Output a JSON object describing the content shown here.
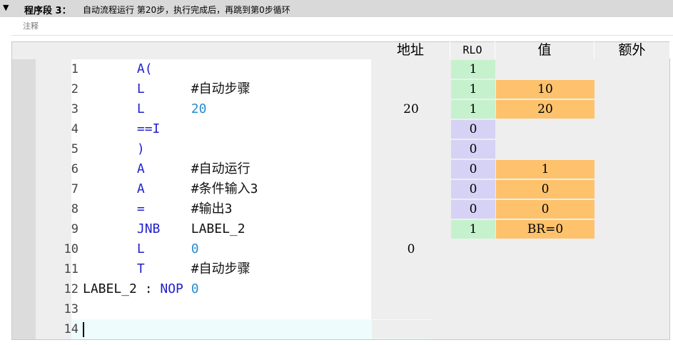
{
  "header": {
    "collapse_icon": "triangle-down-icon",
    "segment_title": "程序段 3：",
    "segment_description": "自动流程运行 第20步，执行完成后，再跳到第0步循环"
  },
  "comment_label": "注释",
  "columns": {
    "address": "地址",
    "rlo": "RLO",
    "value": "值",
    "extra": "额外"
  },
  "rows": [
    {
      "line": "1",
      "op": "A(",
      "operand": "",
      "operand_type": "none",
      "address": "",
      "rlo": "1",
      "value": "",
      "extra": ""
    },
    {
      "line": "2",
      "op": "L",
      "operand": "#自动步骤",
      "operand_type": "text",
      "address": "",
      "rlo": "1",
      "value": "10",
      "extra": ""
    },
    {
      "line": "3",
      "op": "L",
      "operand": "20",
      "operand_type": "num",
      "address": "20",
      "rlo": "1",
      "value": "20",
      "extra": ""
    },
    {
      "line": "4",
      "op": "==I",
      "operand": "",
      "operand_type": "none",
      "address": "",
      "rlo": "0",
      "value": "",
      "extra": ""
    },
    {
      "line": "5",
      "op": ")",
      "operand": "",
      "operand_type": "none",
      "address": "",
      "rlo": "0",
      "value": "",
      "extra": ""
    },
    {
      "line": "6",
      "op": "A",
      "operand": "#自动运行",
      "operand_type": "text",
      "address": "",
      "rlo": "0",
      "value": "1",
      "extra": ""
    },
    {
      "line": "7",
      "op": "A",
      "operand": "#条件输入3",
      "operand_type": "text",
      "address": "",
      "rlo": "0",
      "value": "0",
      "extra": ""
    },
    {
      "line": "8",
      "op": "=",
      "operand": "#输出3",
      "operand_type": "text",
      "address": "",
      "rlo": "0",
      "value": "0",
      "extra": ""
    },
    {
      "line": "9",
      "op": "JNB",
      "operand": "LABEL_2",
      "operand_type": "text",
      "address": "",
      "rlo": "1",
      "value": "BR=0",
      "extra": ""
    },
    {
      "line": "10",
      "op": "L",
      "operand": "0",
      "operand_type": "num",
      "address": "0",
      "rlo": "",
      "value": "",
      "extra": ""
    },
    {
      "line": "11",
      "op": "T",
      "operand": "#自动步骤",
      "operand_type": "text",
      "address": "",
      "rlo": "",
      "value": "",
      "extra": ""
    },
    {
      "line": "12",
      "label": "LABEL_2",
      "label_sep": " : ",
      "op": "NOP",
      "operand": "0",
      "operand_type": "num",
      "address": "",
      "rlo": "",
      "value": "",
      "extra": ""
    },
    {
      "line": "13",
      "op": "",
      "operand": "",
      "operand_type": "none",
      "address": "",
      "rlo": "",
      "value": "",
      "extra": ""
    },
    {
      "line": "14",
      "op": "",
      "operand": "",
      "operand_type": "none",
      "address": "",
      "rlo": "",
      "value": "",
      "extra": "",
      "active": true
    }
  ],
  "colors": {
    "rlo_true": "#c6f1cd",
    "rlo_false": "#d5d2f5",
    "value_highlight": "#fdc26b",
    "keyword": "#2222cc",
    "numeric_operand": "#2a8bd0"
  }
}
